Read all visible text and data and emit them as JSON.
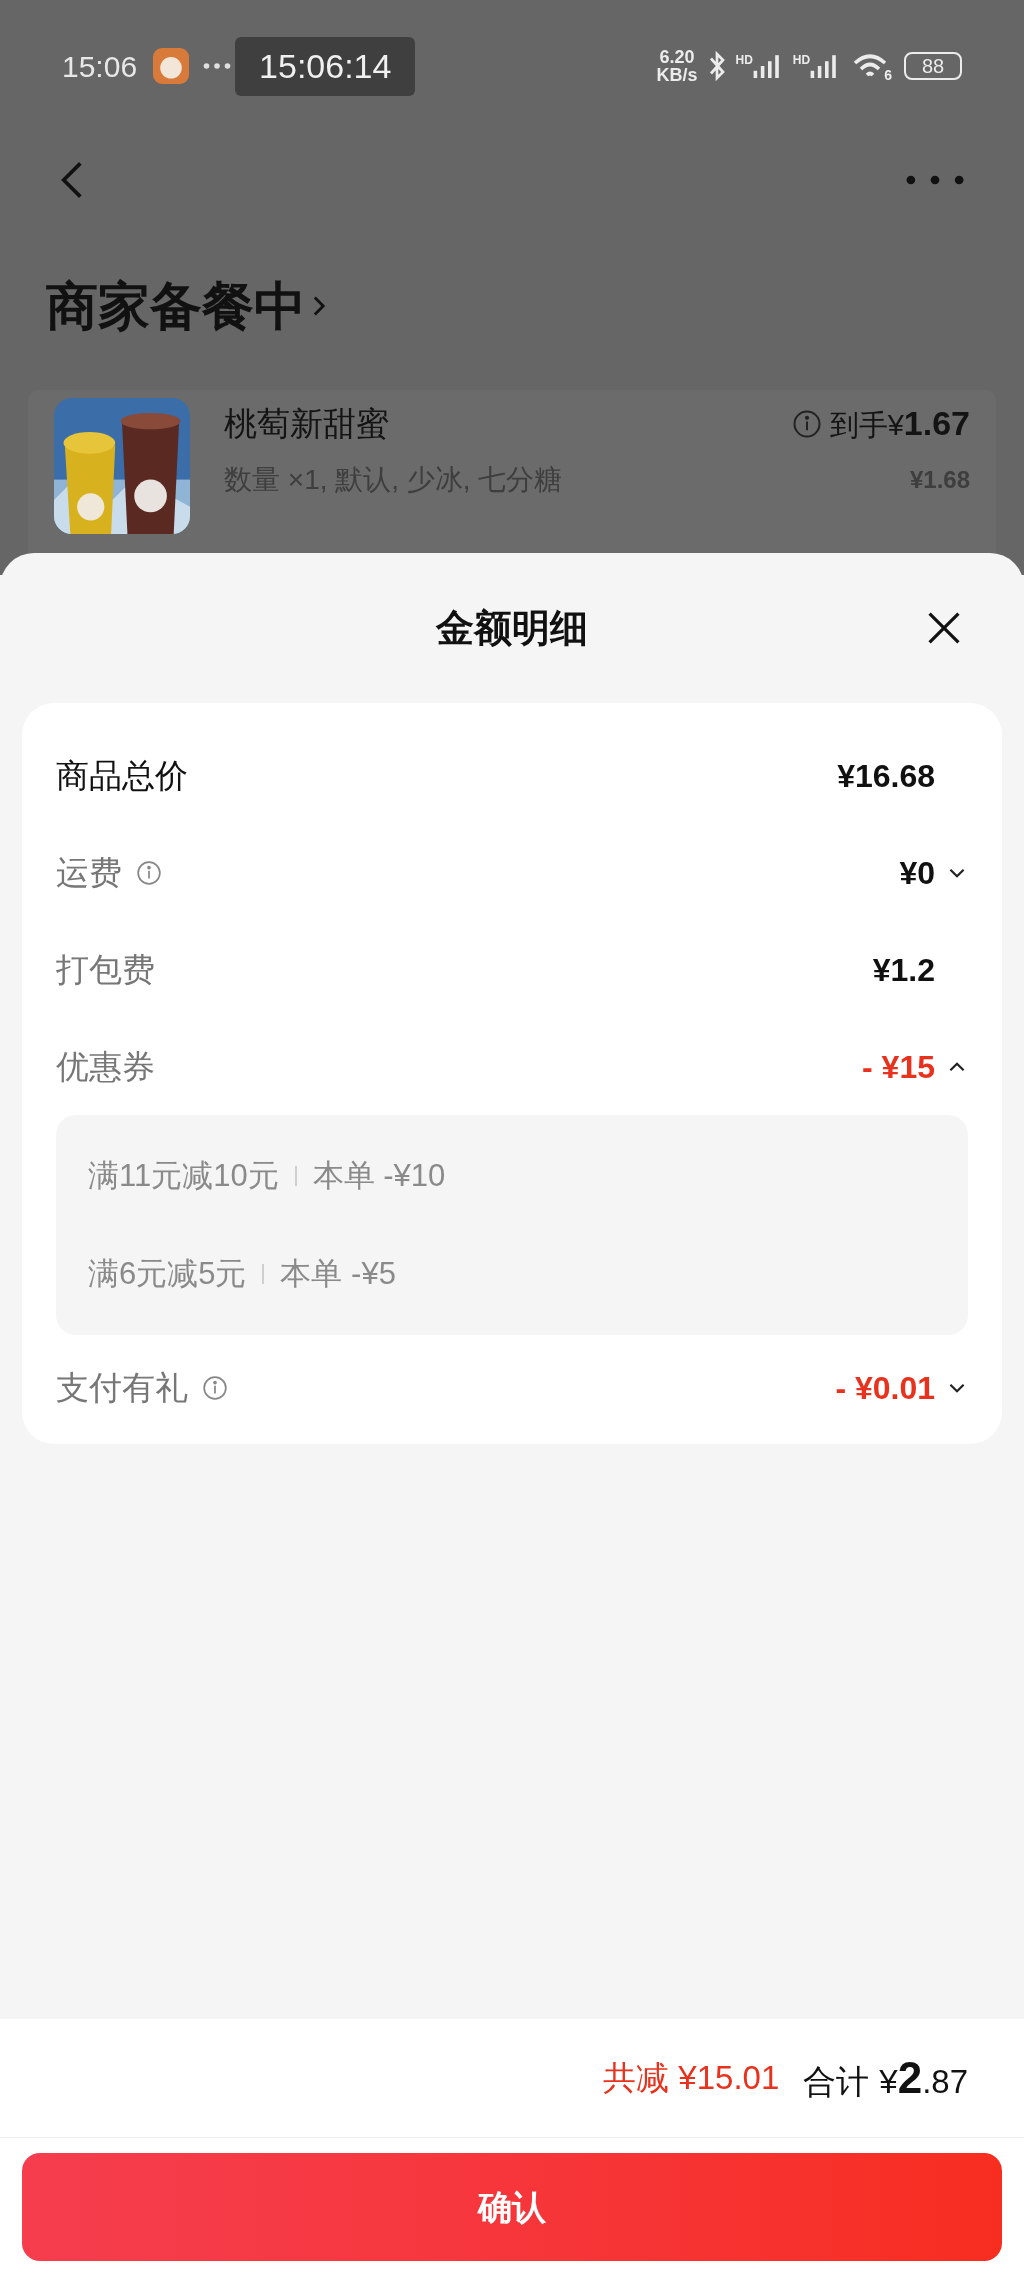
{
  "status_bar": {
    "time": "15:06",
    "speed_value": "6.20",
    "speed_unit": "KB/s",
    "signal_labels": [
      "HD",
      "HD"
    ],
    "wifi_badge": "6",
    "battery": "88"
  },
  "capture_time": "15:06:14",
  "page": {
    "title": "商家备餐中",
    "product": {
      "name": "桃萄新甜蜜",
      "final_price": "到手¥**1.67**",
      "options": "数量 ×1, 默认, 少冰, 七分糖",
      "price": "¥1.68"
    }
  },
  "sheet": {
    "title": "金额明细",
    "rows": [
      {
        "kind": "total",
        "label": "商品总价",
        "value": "¥16.68",
        "info": false
      },
      {
        "kind": "fee",
        "label": "运费",
        "value": "¥0",
        "info": true,
        "expanded": false
      },
      {
        "kind": "fee",
        "label": "打包费",
        "value": "¥1.2",
        "info": false
      },
      {
        "kind": "discount",
        "label": "优惠券",
        "value": "- ¥15",
        "info": false,
        "expanded": true,
        "coupons": [
          {
            "condition": "满11元减10元",
            "amount": "本单 -¥10"
          },
          {
            "condition": "满6元减5元",
            "amount": "本单 -¥5"
          }
        ]
      },
      {
        "kind": "discount",
        "label": "支付有礼",
        "value": "- ¥0.01",
        "info": true,
        "expanded": false
      }
    ]
  },
  "footer": {
    "saved": "共减 ¥15.01",
    "total_label": "合计",
    "total": "¥**2**.87",
    "confirm": "确认"
  }
}
